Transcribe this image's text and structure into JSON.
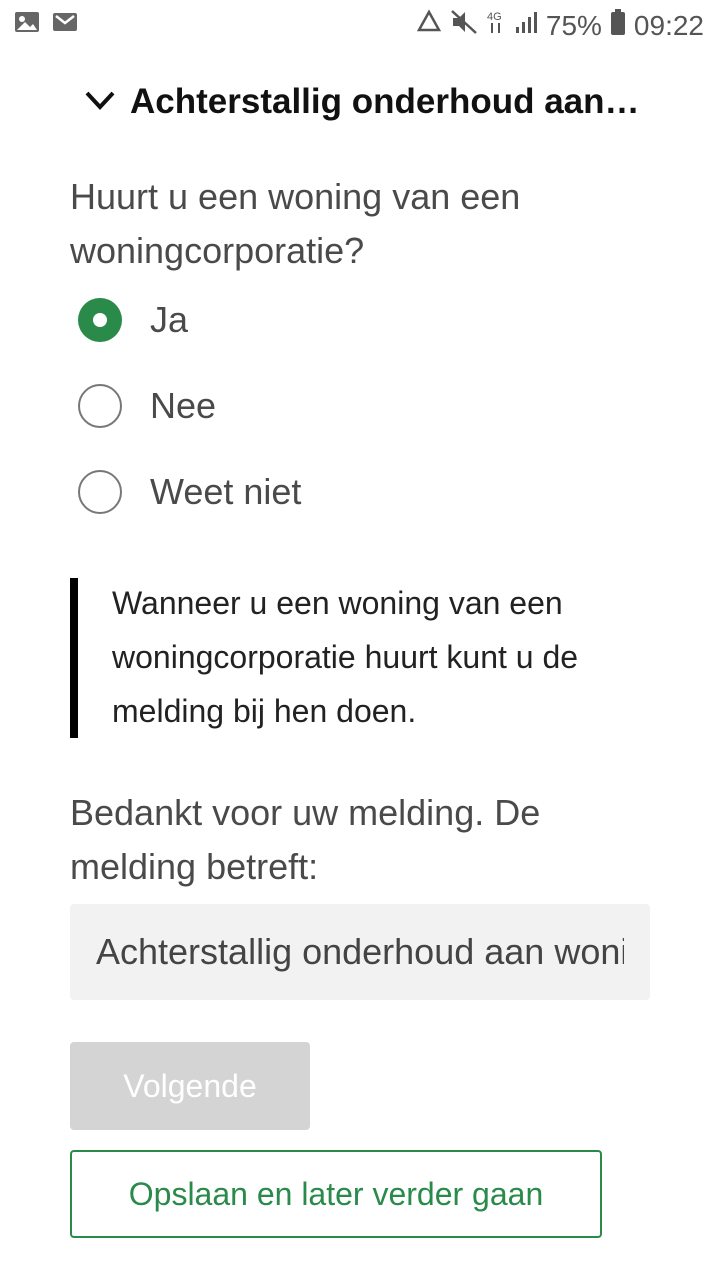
{
  "status_bar": {
    "left_icons": [
      "image-icon",
      "mail-icon"
    ],
    "right_icons": [
      "recycle-icon",
      "mute-icon",
      "network-4g-icon",
      "signal-icon",
      "battery-icon"
    ],
    "battery_percent": "75%",
    "time": "09:22"
  },
  "header": {
    "title": "Achterstallig onderhoud aan…",
    "toggle_icon": "chevron-down-icon"
  },
  "question": {
    "text": "Huurt u een woning van een woningcorporatie?",
    "options": [
      {
        "label": "Ja",
        "selected": true
      },
      {
        "label": "Nee",
        "selected": false
      },
      {
        "label": "Weet niet",
        "selected": false
      }
    ]
  },
  "callout": {
    "text": "Wanneer u een woning van een woningcorporatie huurt kunt u de melding bij hen doen."
  },
  "summary": {
    "text": "Bedankt voor uw melding. De melding betreft:",
    "value": "Achterstallig onderhoud aan woning"
  },
  "buttons": {
    "next_label": "Volgende",
    "save_label": "Opslaan en later verder gaan"
  },
  "colors": {
    "accent": "#2a8a4a",
    "disabled": "#d4d4d4",
    "field_bg": "#f2f2f2"
  }
}
